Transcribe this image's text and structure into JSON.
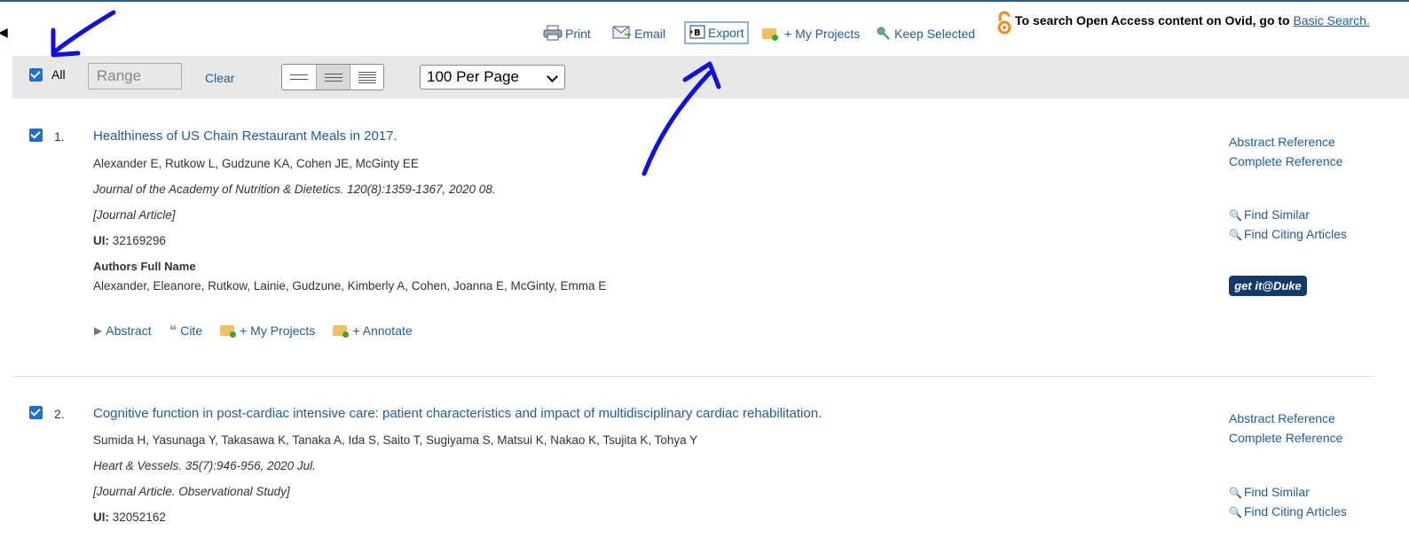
{
  "toolbar": {
    "print": "Print",
    "email": "Email",
    "export": "Export",
    "my_projects": "+ My Projects",
    "keep_selected": "Keep Selected",
    "oa_text": "To search Open Access content on Ovid, go to",
    "oa_link": "Basic Search."
  },
  "controls": {
    "all_label": "All",
    "range_placeholder": "Range",
    "clear": "Clear",
    "per_page": "100 Per Page"
  },
  "results": [
    {
      "number": "1.",
      "title": "Healthiness of US Chain Restaurant Meals in 2017.",
      "authors": "Alexander E, Rutkow L, Gudzune KA, Cohen JE, McGinty EE",
      "source": "Journal of the Academy of Nutrition & Dietetics. 120(8):1359-1367, 2020 08.",
      "type": "[Journal Article]",
      "ui_label": "UI:",
      "ui": "32169296",
      "afn_label": "Authors Full Name",
      "afn": "Alexander, Eleanore, Rutkow, Lainie, Gudzune, Kimberly A, Cohen, Joanna E, McGinty, Emma E",
      "actions": {
        "abstract": "Abstract",
        "cite": "Cite",
        "my_projects": "+ My Projects",
        "annotate": "+ Annotate"
      },
      "links": {
        "abstract_ref": "Abstract Reference",
        "complete_ref": "Complete Reference",
        "find_similar": "Find Similar",
        "find_citing": "Find Citing Articles",
        "getit": "get it@Duke"
      }
    },
    {
      "number": "2.",
      "title": "Cognitive function in post-cardiac intensive care: patient characteristics and impact of multidisciplinary cardiac rehabilitation.",
      "authors": "Sumida H, Yasunaga Y, Takasawa K, Tanaka A, Ida S, Saito T, Sugiyama S, Matsui K, Nakao K, Tsujita K, Tohya Y",
      "source": "Heart & Vessels. 35(7):946-956, 2020 Jul.",
      "type": "[Journal Article. Observational Study]",
      "ui_label": "UI:",
      "ui": "32052162",
      "links": {
        "abstract_ref": "Abstract Reference",
        "complete_ref": "Complete Reference",
        "find_similar": "Find Similar",
        "find_citing": "Find Citing Articles"
      }
    }
  ],
  "colors": {
    "link": "#1f5c99",
    "checkbox": "#1a6fd1",
    "bar": "#e8e8e8",
    "annotation": "#1010e0",
    "oa_icon": "#f58a1f"
  }
}
